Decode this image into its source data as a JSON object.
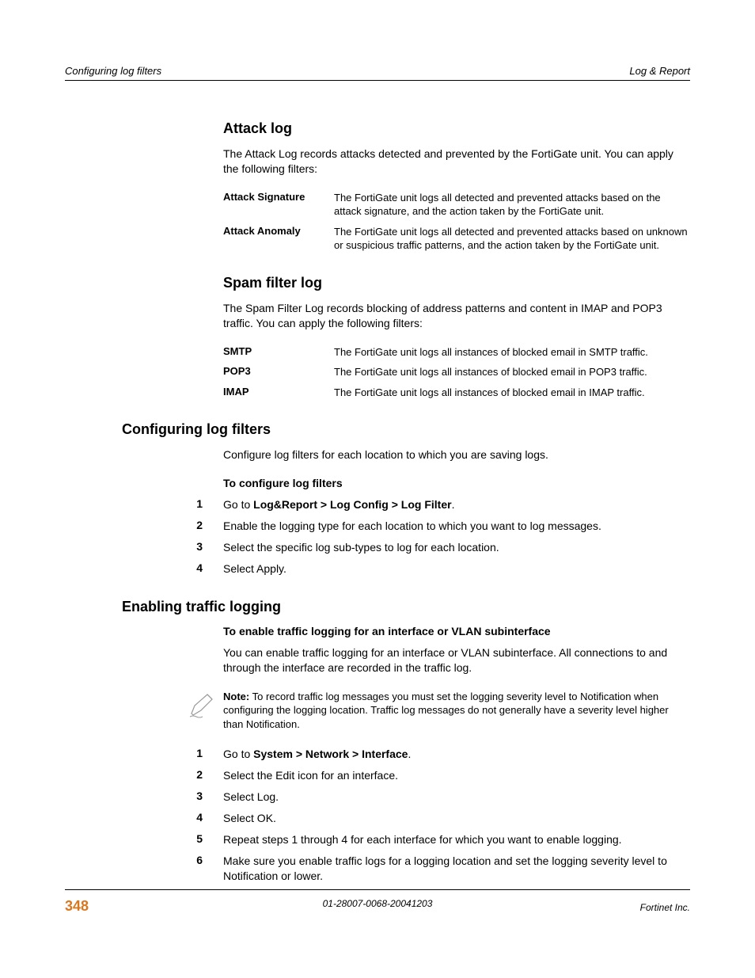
{
  "header": {
    "left": "Configuring log filters",
    "right": "Log & Report"
  },
  "attack": {
    "title": "Attack log",
    "intro": "The Attack Log records attacks detected and prevented by the FortiGate unit. You can apply the following filters:",
    "rows": [
      {
        "label": "Attack Signature",
        "desc": "The FortiGate unit logs all detected and prevented attacks based on the attack signature, and the action taken by the FortiGate unit."
      },
      {
        "label": "Attack Anomaly",
        "desc": "The FortiGate unit logs all detected and prevented attacks based on unknown or suspicious traffic patterns, and the action taken by the FortiGate unit."
      }
    ]
  },
  "spam": {
    "title": "Spam filter log",
    "intro": "The Spam Filter Log records blocking of address patterns and content in IMAP and POP3 traffic. You can apply the following filters:",
    "rows": [
      {
        "label": "SMTP",
        "desc": "The FortiGate unit logs all instances of blocked email in SMTP traffic."
      },
      {
        "label": "POP3",
        "desc": "The FortiGate unit logs all instances of blocked email in POP3 traffic."
      },
      {
        "label": "IMAP",
        "desc": "The FortiGate unit logs all instances of blocked email in IMAP traffic."
      }
    ]
  },
  "config": {
    "title": "Configuring log filters",
    "intro": "Configure log filters for each location to which you are saving logs.",
    "subhead": "To configure log filters",
    "steps": [
      {
        "num": "1",
        "pre": "Go to ",
        "bold": "Log&Report > Log Config > Log Filter",
        "post": "."
      },
      {
        "num": "2",
        "text": "Enable the logging type for each location to which you want to log messages."
      },
      {
        "num": "3",
        "text": "Select the specific log sub-types to log for each location."
      },
      {
        "num": "4",
        "text": "Select Apply."
      }
    ]
  },
  "traffic": {
    "title": "Enabling traffic logging",
    "subhead": "To enable traffic logging for an interface or VLAN subinterface",
    "intro": "You can enable traffic logging for an interface or VLAN subinterface. All connections to and through the interface are recorded in the traffic log.",
    "note_label": "Note:",
    "note_text": " To record traffic log messages you must set the logging severity level to Notification when configuring the logging location. Traffic log messages do not generally have a severity level higher than Notification.",
    "steps": [
      {
        "num": "1",
        "pre": "Go to ",
        "bold": "System > Network > Interface",
        "post": "."
      },
      {
        "num": "2",
        "text": "Select the Edit icon for an interface."
      },
      {
        "num": "3",
        "text": "Select Log."
      },
      {
        "num": "4",
        "text": "Select OK."
      },
      {
        "num": "5",
        "text": "Repeat steps 1 through 4 for each interface for which you want to enable logging."
      },
      {
        "num": "6",
        "text": "Make sure you enable traffic logs for a logging location and set the logging severity level to Notification or lower."
      }
    ]
  },
  "footer": {
    "page": "348",
    "docid": "01-28007-0068-20041203",
    "company": "Fortinet Inc."
  }
}
